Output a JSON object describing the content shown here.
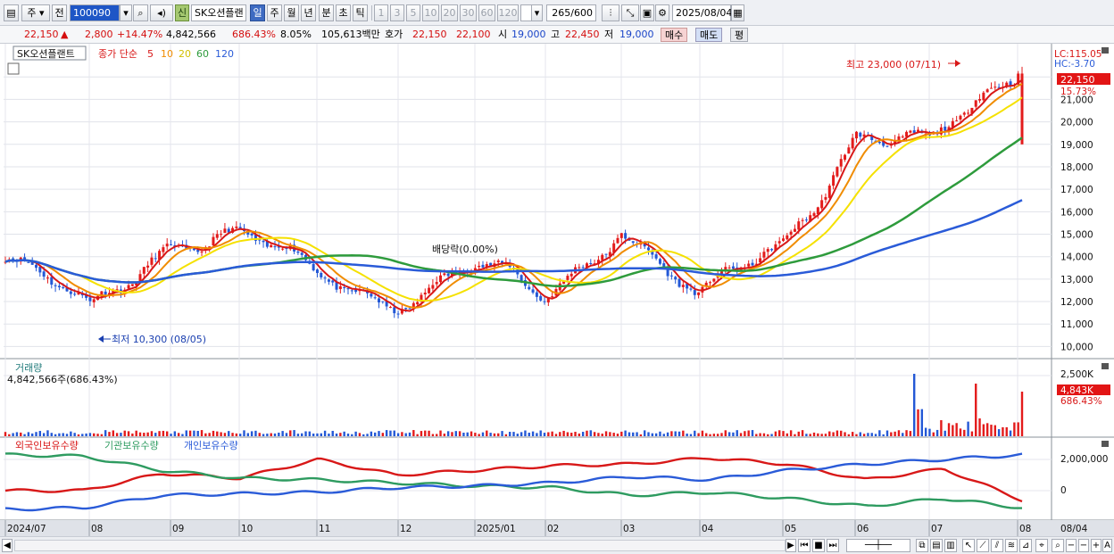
{
  "toolbar": {
    "type_select": "주",
    "prev_btn": "전",
    "code": "100090",
    "market_badge": "신",
    "stock_name": "SK오션플랜",
    "periods": [
      "일",
      "주",
      "월",
      "년",
      "분",
      "초",
      "틱"
    ],
    "active_period": "일",
    "intervals": [
      "1",
      "3",
      "5",
      "10",
      "20",
      "30",
      "60",
      "120"
    ],
    "count": "265",
    "count_max": "/600",
    "date": "2025/08/04"
  },
  "quote": {
    "price": "22,150",
    "arrow": "▲",
    "change": "2,800",
    "change_pct": "+14.47%",
    "volume": "4,842,566",
    "volume_pct": "686.43%",
    "turnover": "8.05%",
    "amount": "105,613백만",
    "bid_label": "호가",
    "ask": "22,150",
    "bid": "22,100",
    "open_label": "시",
    "open": "19,000",
    "high_label": "고",
    "high": "22,450",
    "low_label": "저",
    "low": "19,000",
    "buy_btn": "매수",
    "sell_btn": "매도",
    "eval_btn": "평"
  },
  "price_panel": {
    "name_tag": "SK오션플랜트",
    "ma_title": "종가 단순",
    "ma_periods": [
      "5",
      "10",
      "20",
      "60",
      "120"
    ],
    "ma_colors": [
      "#d81818",
      "#f08c00",
      "#f5e100",
      "#2e9b3c",
      "#2a5bd8"
    ],
    "lc": "LC:115.05",
    "hc": "HC:-3.70",
    "last_price_tag": "22,150",
    "last_pct_tag": "15.73%",
    "high_note": "최고 23,000 (07/11)",
    "low_note": "최저 10,300 (08/05)",
    "dividend_note": "배당락(0.00%)",
    "y_ticks": [
      "22,000",
      "21,000",
      "20,000",
      "19,000",
      "18,000",
      "17,000",
      "16,000",
      "15,000",
      "14,000",
      "13,000",
      "12,000",
      "11,000",
      "10,000"
    ]
  },
  "volume_panel": {
    "title": "거래량",
    "value": "4,842,566주(686.43%)",
    "tag": "4,843K",
    "tag_pct": "686.43%",
    "y_tick": "2,500K"
  },
  "holding_panel": {
    "legend": [
      "외국인보유수량",
      "기관보유수량",
      "개인보유수량"
    ],
    "colors": [
      "#d81818",
      "#2e9b60",
      "#2a5bd8"
    ],
    "y_ticks": [
      "2,000,000",
      "0"
    ]
  },
  "x_axis": {
    "labels": [
      "2024/07",
      "08",
      "09",
      "10",
      "11",
      "12",
      "2025/01",
      "02",
      "03",
      "04",
      "05",
      "06",
      "07",
      "08"
    ],
    "right_label": "08/04"
  },
  "chart_data": [
    {
      "type": "line",
      "title": "SK오션플랜트",
      "ylim": [
        9500,
        23400
      ],
      "x": [
        "2024/07",
        "08",
        "09",
        "10",
        "11",
        "12",
        "2025/01",
        "02",
        "03",
        "04",
        "05",
        "06",
        "07",
        "08/04"
      ],
      "series": [
        {
          "name": "종가",
          "values": [
            13900,
            11700,
            14700,
            15000,
            13200,
            11900,
            13600,
            12100,
            15300,
            12100,
            14600,
            19500,
            19000,
            22150
          ]
        },
        {
          "name": "120",
          "values": [
            14500,
            14000,
            13800,
            13900,
            14000,
            13800,
            13650,
            13600,
            13700,
            13600,
            13800,
            14800,
            15400,
            16900
          ]
        }
      ],
      "annotations": [
        "최고 23,000 (07/11)",
        "최저 10,300 (08/05)",
        "배당락(0.00%)"
      ]
    },
    {
      "type": "bar",
      "title": "거래량",
      "last_value": 4842566,
      "note": "4,842,566주(686.43%)"
    },
    {
      "type": "line",
      "title": "보유수량",
      "x": [
        "2024/07",
        "08",
        "09",
        "10",
        "11",
        "12",
        "2025/01",
        "02",
        "03",
        "04",
        "05",
        "06",
        "07",
        "08/04"
      ],
      "series": [
        {
          "name": "외국인보유수량",
          "values": [
            0,
            0,
            1100000,
            800000,
            2000000,
            1000000,
            1300000,
            1600000,
            1700000,
            2100000,
            1700000,
            700000,
            1400000,
            -600000
          ]
        },
        {
          "name": "기관보유수량",
          "values": [
            2300000,
            2200000,
            1300000,
            800000,
            700000,
            500000,
            300000,
            200000,
            -300000,
            -100000,
            -500000,
            -1000000,
            -500000,
            -1100000
          ]
        },
        {
          "name": "개인보유수량",
          "values": [
            -1200000,
            -1100000,
            -300000,
            -200000,
            -100000,
            200000,
            300000,
            500000,
            900000,
            700000,
            1300000,
            1700000,
            2000000,
            2300000
          ]
        }
      ]
    }
  ]
}
